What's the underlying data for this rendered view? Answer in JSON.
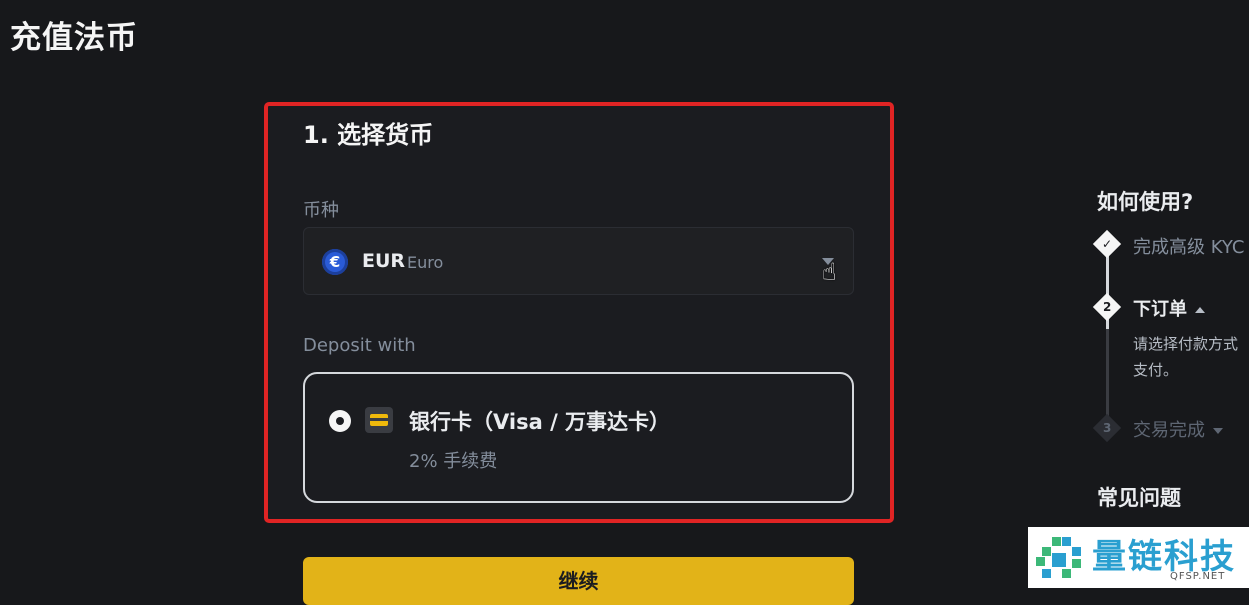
{
  "page": {
    "title": "充值法币"
  },
  "step1": {
    "title": "1. 选择货币",
    "currency_label": "币种",
    "currency": {
      "code": "EUR",
      "name": "Euro",
      "icon": "€"
    },
    "deposit_label": "Deposit with",
    "method": {
      "label": "银行卡（Visa / 万事达卡）",
      "fee": "2% 手续费",
      "selected": true
    }
  },
  "continue_label": "继续",
  "help": {
    "title": "如何使用?",
    "steps": [
      {
        "label": "完成高级 KYC",
        "state": "done"
      },
      {
        "number": "2",
        "label": "下订单",
        "desc": "请选择付款方式\n支付。",
        "state": "current"
      },
      {
        "number": "3",
        "label": "交易完成",
        "state": "pending"
      }
    ],
    "faq_title": "常见问题"
  },
  "watermark": {
    "text": "量链科技",
    "sub": "QFSP.NET"
  },
  "colors": {
    "accent": "#e2b318",
    "highlight_border": "#e02424",
    "background": "#17181b"
  }
}
